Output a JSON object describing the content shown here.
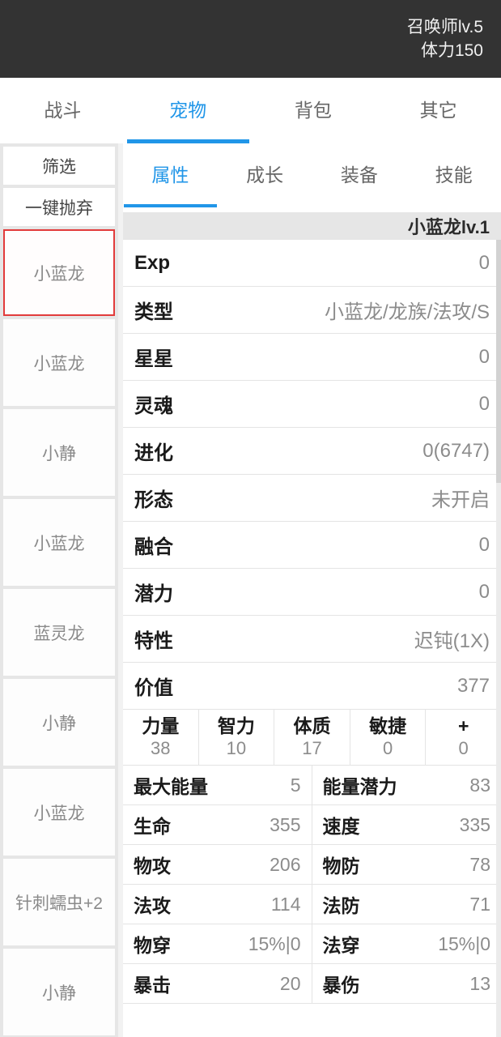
{
  "statusbar": {
    "level_text": "召唤师lv.5",
    "stamina_text": "体力150",
    "background": "#333333"
  },
  "main_tabs": [
    {
      "label": "战斗",
      "active": false
    },
    {
      "label": "宠物",
      "active": true
    },
    {
      "label": "背包",
      "active": false
    },
    {
      "label": "其它",
      "active": false
    }
  ],
  "accent_color": "#2196e8",
  "selected_border_color": "#e23b3b",
  "sidebar": {
    "buttons": [
      {
        "label": "筛选"
      },
      {
        "label": "一键抛弃"
      }
    ],
    "pets": [
      {
        "label": "小蓝龙",
        "selected": true
      },
      {
        "label": "小蓝龙",
        "selected": false
      },
      {
        "label": "小静",
        "selected": false
      },
      {
        "label": "小蓝龙",
        "selected": false
      },
      {
        "label": "蓝灵龙",
        "selected": false
      },
      {
        "label": "小静",
        "selected": false
      },
      {
        "label": "小蓝龙",
        "selected": false
      },
      {
        "label": "针刺蠕虫+2",
        "selected": false
      },
      {
        "label": "小静",
        "selected": false
      }
    ]
  },
  "sub_tabs": [
    {
      "label": "属性",
      "active": true
    },
    {
      "label": "成长",
      "active": false
    },
    {
      "label": "装备",
      "active": false
    },
    {
      "label": "技能",
      "active": false
    }
  ],
  "pet_detail": {
    "title": "小蓝龙lv.1",
    "rows": [
      {
        "label": "Exp",
        "value": "0"
      },
      {
        "label": "类型",
        "value": "小蓝龙/龙族/法攻/S"
      },
      {
        "label": "星星",
        "value": "0"
      },
      {
        "label": "灵魂",
        "value": "0"
      },
      {
        "label": "进化",
        "value": "0(6747)"
      },
      {
        "label": "形态",
        "value": "未开启"
      },
      {
        "label": "融合",
        "value": "0"
      },
      {
        "label": "潜力",
        "value": "0"
      },
      {
        "label": "特性",
        "value": "迟钝(1X)"
      },
      {
        "label": "价值",
        "value": "377"
      }
    ],
    "attributes": [
      {
        "name": "力量",
        "value": "38"
      },
      {
        "name": "智力",
        "value": "10"
      },
      {
        "name": "体质",
        "value": "17"
      },
      {
        "name": "敏捷",
        "value": "0"
      },
      {
        "name": "+",
        "value": "0"
      }
    ],
    "stats": [
      [
        {
          "label": "最大能量",
          "value": "5"
        },
        {
          "label": "能量潜力",
          "value": "83"
        }
      ],
      [
        {
          "label": "生命",
          "value": "355"
        },
        {
          "label": "速度",
          "value": "335"
        }
      ],
      [
        {
          "label": "物攻",
          "value": "206"
        },
        {
          "label": "物防",
          "value": "78"
        }
      ],
      [
        {
          "label": "法攻",
          "value": "114"
        },
        {
          "label": "法防",
          "value": "71"
        }
      ],
      [
        {
          "label": "物穿",
          "value": "15%|0"
        },
        {
          "label": "法穿",
          "value": "15%|0"
        }
      ],
      [
        {
          "label": "暴击",
          "value": "20"
        },
        {
          "label": "暴伤",
          "value": "13"
        }
      ]
    ]
  }
}
